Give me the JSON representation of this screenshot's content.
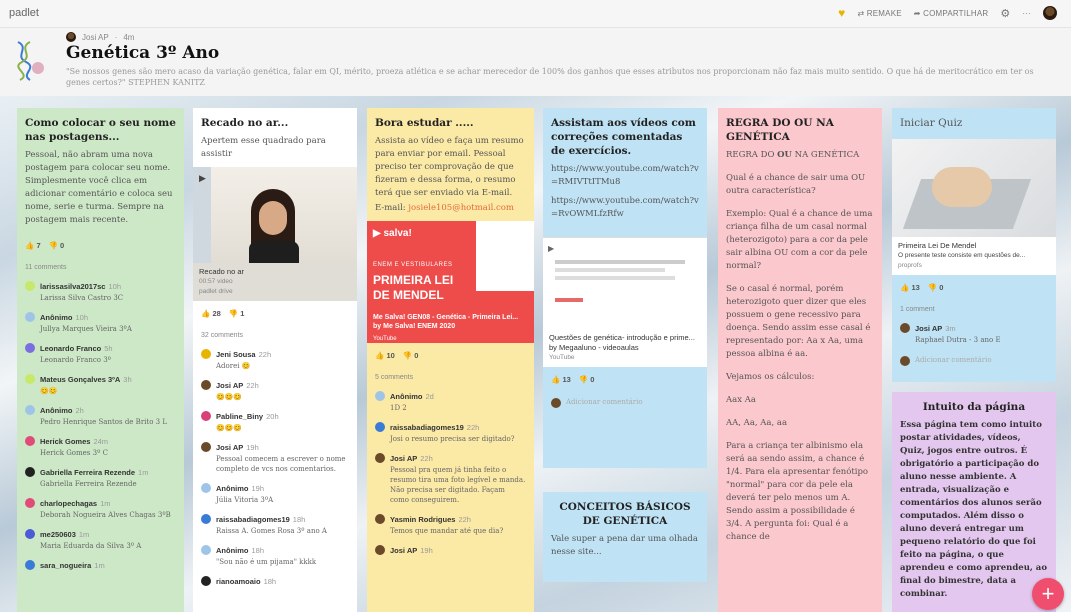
{
  "app": {
    "brand": "padlet"
  },
  "toolbar": {
    "remake": "⇄ REMAKE",
    "share": "➦ COMPARTILHAR",
    "more": "···"
  },
  "header": {
    "author": "Josi AP",
    "time": "4m",
    "title": "Genética 3º Ano",
    "description": "\"Se nossos genes são mero acaso da variação genética, falar em QI, mérito, proeza atlética e se achar merecedor de 100% dos ganhos que esses atributos nos proporcionam não faz mais muito sentido. O que há de meritocrático em ter os genes certos?\" STEPHEN KANITZ"
  },
  "col1": {
    "title": "Como colocar o seu nome nas postagens...",
    "body": "Pessoal, não abram uma nova postagem para colocar seu nome. Simplesmente você clica em adicionar comentário e coloca seu nome, serie e turma. Sempre na postagem mais recente.",
    "likes": "7",
    "dislikes": "0",
    "comment_count": "11 comments",
    "comments": [
      {
        "name": "larissasilva2017sc",
        "time": "10h",
        "text": "Larissa Silva Castro 3C",
        "color": "#c8e86a"
      },
      {
        "name": "Anônimo",
        "time": "10h",
        "text": "Jullya Marques Vieira 3ºA",
        "color": "#9ec5e8"
      },
      {
        "name": "Leonardo Franco",
        "time": "5h",
        "text": "Leonardo Franco 3º",
        "color": "#7a6fe0"
      },
      {
        "name": "Mateus Gonçalves 3ºA",
        "time": "3h",
        "text": "😊😊",
        "color": "#c8e86a"
      },
      {
        "name": "Anônimo",
        "time": "2h",
        "text": "Pedro Henrique Santos de Brito 3 L",
        "color": "#9ec5e8"
      },
      {
        "name": "Herick Gomes",
        "time": "24m",
        "text": "Herick Gomes 3º C",
        "color": "#e14b7a"
      },
      {
        "name": "Gabriella Ferreira Rezende",
        "time": "1m",
        "text": "Gabriella Ferreira Rezende",
        "color": "#222222"
      },
      {
        "name": "charlopechagas",
        "time": "1m",
        "text": "Deborah Nogueira Alves Chagas 3ºB",
        "color": "#e14b7a"
      },
      {
        "name": "me250603",
        "time": "1m",
        "text": "Maria Eduarda da Silva 3º A",
        "color": "#4b5bd6"
      },
      {
        "name": "sara_nogueira",
        "time": "1m",
        "text": "",
        "color": "#3a7bd5"
      }
    ]
  },
  "col2": {
    "title": "Recado no ar...",
    "body": "Apertem esse quadrado para assistir",
    "video_title": "Recado no ar",
    "video_meta": "00:57 video",
    "video_source": "padlet drive",
    "likes": "28",
    "dislikes": "1",
    "comment_count": "32 comments",
    "comments": [
      {
        "name": "Jeni Sousa",
        "time": "22h",
        "text": "Adorei 😊",
        "color": "#e8b400"
      },
      {
        "name": "Josi AP",
        "time": "22h",
        "text": "😊😊😊",
        "color": "#6b4a2a"
      },
      {
        "name": "Pabline_Biny",
        "time": "20h",
        "text": "😊😊😊",
        "color": "#d8407a"
      },
      {
        "name": "Josi AP",
        "time": "19h",
        "text": "Pessoal comecem a escrever o nome completo de vcs nos comentarios.",
        "color": "#6b4a2a"
      },
      {
        "name": "Anônimo",
        "time": "19h",
        "text": "Júlia Vitoria 3ºA",
        "color": "#9ec5e8"
      },
      {
        "name": "raissabadiagomes19",
        "time": "18h",
        "text": "Raissa A. Gomes Rosa 3º ano A",
        "color": "#3a7bd5"
      },
      {
        "name": "Anônimo",
        "time": "18h",
        "text": "\"Sou não é um pijama\" kkkk",
        "color": "#9ec5e8"
      },
      {
        "name": "rianoamoaio",
        "time": "18h",
        "text": "",
        "color": "#222222"
      }
    ]
  },
  "col3": {
    "title": "Bora estudar .....",
    "body": "Assista ao vídeo e faça um resumo para enviar por email. Pessoal preciso ter comprovação de que fizeram e dessa forma, o resumo terá que ser enviado via E-mail.",
    "email_label": "E-mail:",
    "email": "josiele105@hotmail.com",
    "video_tag": "ENEM E VESTIBULARES",
    "video_heading": "PRIMEIRA LEI DE MENDEL",
    "video_caption": "Me Salva! GEN08 - Genética - Primeira Lei... by Me Salva! ENEM 2020",
    "video_source": "YouTube",
    "likes": "10",
    "dislikes": "0",
    "comment_count": "5 comments",
    "comments": [
      {
        "name": "Anônimo",
        "time": "2d",
        "text": "1D 2",
        "color": "#9ec5e8"
      },
      {
        "name": "raissabadiagomes19",
        "time": "22h",
        "text": "Josi o resumo precisa ser digitado?",
        "color": "#3a7bd5"
      },
      {
        "name": "Josi AP",
        "time": "22h",
        "text": "Pessoal pra quem já tinha feito o resumo tira uma foto legível e manda. Não precisa ser digitado. Façam como conseguirem.",
        "color": "#6b4a2a"
      },
      {
        "name": "Yasmin Rodrigues",
        "time": "22h",
        "text": "Temos que mandar até que dia?",
        "color": "#6b4a2a"
      },
      {
        "name": "Josi AP",
        "time": "19h",
        "text": "",
        "color": "#6b4a2a"
      }
    ]
  },
  "col4": {
    "title": "Assistam aos vídeos com correções comentadas de exercícios.",
    "link1": "https://www.youtube.com/watch?v=RMIVTtITMu8",
    "link2": "https://www.youtube.com/watch?v=RvOWMLfzRfw",
    "video_caption": "Questões de genética- introdução e prime... by Megaaluno - videoaulas",
    "video_source": "YouTube",
    "likes": "13",
    "dislikes": "0",
    "add_comment": "Adicionar comentário",
    "card2_title": "CONCEITOS BÁSICOS DE GENÉTICA",
    "card2_body": "Vale super a pena dar uma olhada nesse site..."
  },
  "col5": {
    "title": "REGRA DO OU NA GENÉTICA",
    "subtitle_pre": "REGRA DO ",
    "subtitle_bold": "OU",
    "subtitle_post": " NA GENÉTICA",
    "p1": "Qual é a chance de sair uma OU outra característica?",
    "p2": "Exemplo: Qual é a chance de uma criança filha de um casal normal (heterozigoto) para a cor da pele sair albina OU com a cor da pele normal?",
    "p3": "Se o casal é normal, porém heterozigoto quer dizer que eles possuem o gene recessivo para doença. Sendo assim esse casal é representado por: Aa x Aa, uma pessoa albina é aa.",
    "p4": "Vejamos os cálculos:",
    "p5": "Aax Aa",
    "p6": "AA, Aa, Aa, aa",
    "p7": "Para a criança ter albinismo ela será aa sendo assim, a chance é 1/4. Para ela apresentar fenótipo \"normal\" para cor da pele ela deverá ter pelo menos um A. Sendo assim a possibilidade é 3/4. A pergunta foi: Qual é a chance de"
  },
  "col6": {
    "title": "Iniciar Quiz",
    "link_title": "Primeira Lei De Mendel",
    "link_desc": "O presente teste consiste em questões de...",
    "link_source": "proprofs",
    "likes": "13",
    "dislikes": "0",
    "comment_count": "1 comment",
    "comments": [
      {
        "name": "Josi AP",
        "time": "3m",
        "text": "Raphael Dutra - 3 ano E",
        "color": "#6b4a2a"
      }
    ],
    "add_comment": "Adicionar comentário",
    "card2_title": "Intuito da página",
    "card2_body": "Essa página tem como intuito postar atividades, vídeos, Quiz, jogos entre outros. É obrigatório a participação do aluno nesse ambiente. A entrada, visualização e comentários dos alunos serão computados. Além disso o aluno deverá entregar um pequeno relatório do que foi feito na página, o que aprendeu e como aprendeu, ao final do bimestre, data a combinar."
  },
  "fab": "+"
}
